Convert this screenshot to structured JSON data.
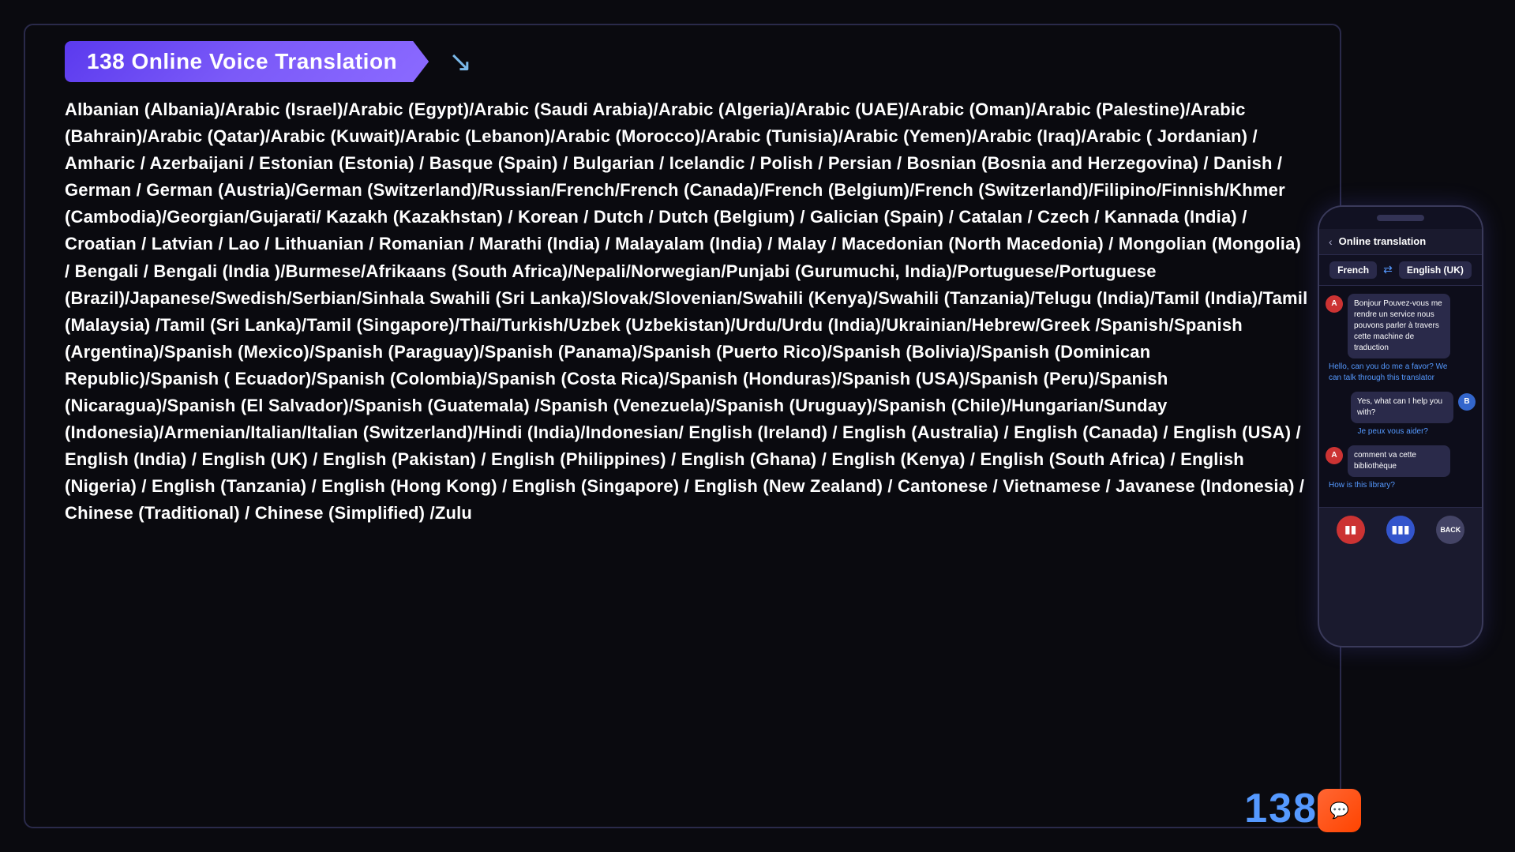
{
  "app": {
    "title": "138 Online Voice Translation",
    "background_color": "#0a0a0f"
  },
  "languages_list": {
    "content": "Albanian (Albania)/Arabic (Israel)/Arabic (Egypt)/Arabic (Saudi Arabia)/Arabic (Algeria)/Arabic (UAE)/Arabic (Oman)/Arabic (Palestine)/Arabic (Bahrain)/Arabic (Qatar)/Arabic (Kuwait)/Arabic (Lebanon)/Arabic (Morocco)/Arabic (Tunisia)/Arabic (Yemen)/Arabic (Iraq)/Arabic ( Jordanian) / Amharic / Azerbaijani / Estonian (Estonia) / Basque (Spain) / Bulgarian / Icelandic / Polish / Persian / Bosnian (Bosnia and Herzegovina) / Danish / German / German (Austria)/German (Switzerland)/Russian/French/French (Canada)/French (Belgium)/French (Switzerland)/Filipino/Finnish/Khmer (Cambodia)/Georgian/Gujarati/ Kazakh (Kazakhstan) / Korean / Dutch / Dutch (Belgium) / Galician (Spain) / Catalan / Czech / Kannada (India) / Croatian / Latvian / Lao / Lithuanian / Romanian / Marathi (India) / Malayalam (India) / Malay / Macedonian (North Macedonia) / Mongolian (Mongolia) / Bengali / Bengali (India )/Burmese/Afrikaans (South Africa)/Nepali/Norwegian/Punjabi (Gurumuchi, India)/Portuguese/Portuguese (Brazil)/Japanese/Swedish/Serbian/Sinhala Swahili (Sri Lanka)/Slovak/Slovenian/Swahili (Kenya)/Swahili (Tanzania)/Telugu (India)/Tamil (India)/Tamil (Malaysia) /Tamil (Sri Lanka)/Tamil (Singapore)/Thai/Turkish/Uzbek (Uzbekistan)/Urdu/Urdu (India)/Ukrainian/Hebrew/Greek /Spanish/Spanish (Argentina)/Spanish (Mexico)/Spanish (Paraguay)/Spanish (Panama)/Spanish (Puerto Rico)/Spanish (Bolivia)/Spanish (Dominican Republic)/Spanish ( Ecuador)/Spanish (Colombia)/Spanish (Costa Rica)/Spanish (Honduras)/Spanish (USA)/Spanish (Peru)/Spanish (Nicaragua)/Spanish (El Salvador)/Spanish (Guatemala) /Spanish (Venezuela)/Spanish (Uruguay)/Spanish (Chile)/Hungarian/Sunday (Indonesia)/Armenian/Italian/Italian (Switzerland)/Hindi (India)/Indonesian/ English (Ireland) / English (Australia) / English (Canada) / English (USA) / English (India) / English (UK) / English (Pakistan) / English (Philippines) / English (Ghana) / English (Kenya) / English (South Africa) / English (Nigeria) / English (Tanzania) / English (Hong Kong) / English (Singapore) / English (New Zealand) / Cantonese / Vietnamese / Javanese (Indonesia) / Chinese (Traditional) / Chinese (Simplified) /Zulu"
  },
  "phone": {
    "header": {
      "back_label": "‹",
      "title": "Online translation"
    },
    "lang_from": "French",
    "lang_to": "English (UK)",
    "swap_symbol": "⇄",
    "messages": [
      {
        "sender": "A",
        "original": "Bonjour Pouvez-vous me rendre un service nous pouvons parler à travers cette machine de traduction",
        "translated": "Hello, can you do me a favor? We can talk through this translator"
      },
      {
        "sender": "B",
        "original": "Yes, what can I help you with?",
        "translated": "Je peux vous aider?"
      },
      {
        "sender": "A",
        "original": "comment va cette bibliothèque",
        "translated": "How is this library?"
      }
    ],
    "controls": {
      "btn1_label": "🎤",
      "btn2_label": "🎵",
      "btn3_label": "BACK"
    }
  },
  "branding": {
    "number": "138"
  }
}
